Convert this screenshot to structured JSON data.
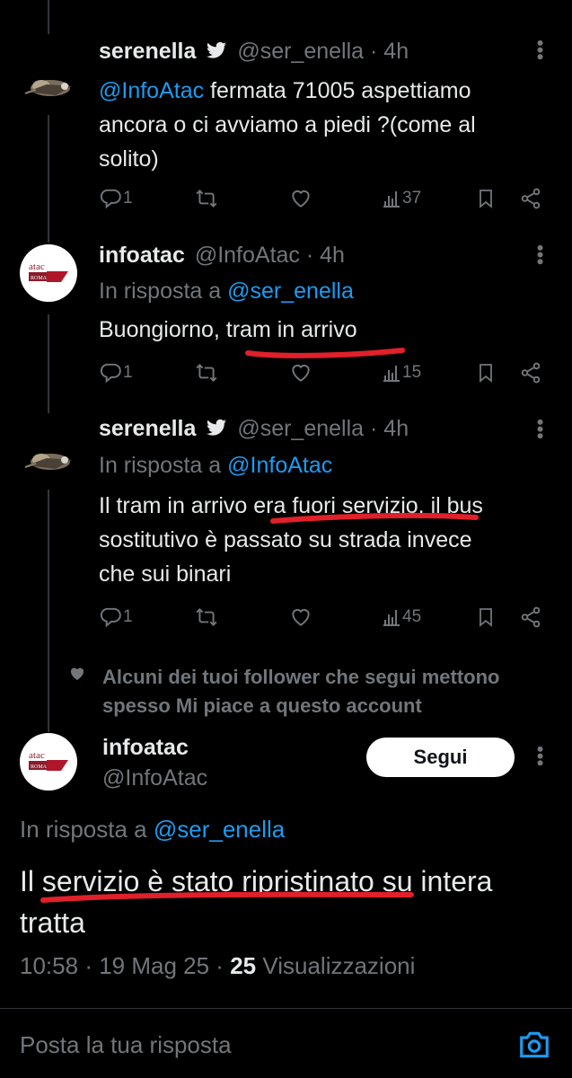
{
  "tweets": [
    {
      "display_name": "serenella",
      "handle": "@ser_enella",
      "time": "· 4h",
      "mention": "@InfoAtac",
      "text_lines": [
        "fermata 71005 aspettiamo",
        "ancora o ci avviamo a piedi ?(come al",
        "solito)"
      ],
      "replies": "1",
      "views": "37"
    },
    {
      "display_name": "infoatac",
      "handle": "@InfoAtac",
      "time": "· 4h",
      "reply_prefix": "In risposta a",
      "reply_to": "@ser_enella",
      "text_before": "Buongiorno, ",
      "text_highlight": "tram in arrivo",
      "replies": "1",
      "views": "15"
    },
    {
      "display_name": "serenella",
      "handle": "@ser_enella",
      "time": "· 4h",
      "reply_prefix": "In risposta a",
      "reply_to": "@InfoAtac",
      "line1_before": "Il tram in arrivo ",
      "line1_highlight": "era fuori servizio",
      "line1_after": ", il bus",
      "line2": "sostitutivo è passato su strada invece",
      "line3": "che sui binari",
      "replies": "1",
      "views": "45"
    }
  ],
  "social_context": {
    "line1": "Alcuni dei tuoi follower che segui mettono",
    "line2": "spesso Mi piace a questo account"
  },
  "main_tweet": {
    "display_name": "infoatac",
    "handle": "@InfoAtac",
    "follow_label": "Segui",
    "reply_prefix": "In risposta a",
    "reply_to": "@ser_enella",
    "text_before": "Il ",
    "text_highlight": "servizio è stato ripristinato",
    "text_after": " su intera",
    "text_line2": "tratta",
    "time": "10:58",
    "date": "· 19 Mag 25 ·",
    "views_count": "25",
    "views_label": "Visualizzazioni"
  },
  "compose": {
    "placeholder": "Posta la tua risposta"
  },
  "avatar_text": {
    "brand": "atac",
    "city": "ROMA"
  },
  "colors": {
    "background": "#000000",
    "text": "#e7e9ea",
    "muted": "#71767b",
    "link": "#1d9bf0",
    "annotation": "#e0202a"
  },
  "icons": [
    "twitter-bird-icon",
    "more-icon",
    "reply-icon",
    "retweet-icon",
    "like-icon",
    "views-icon",
    "bookmark-icon",
    "share-icon",
    "heart-icon",
    "camera-icon"
  ]
}
